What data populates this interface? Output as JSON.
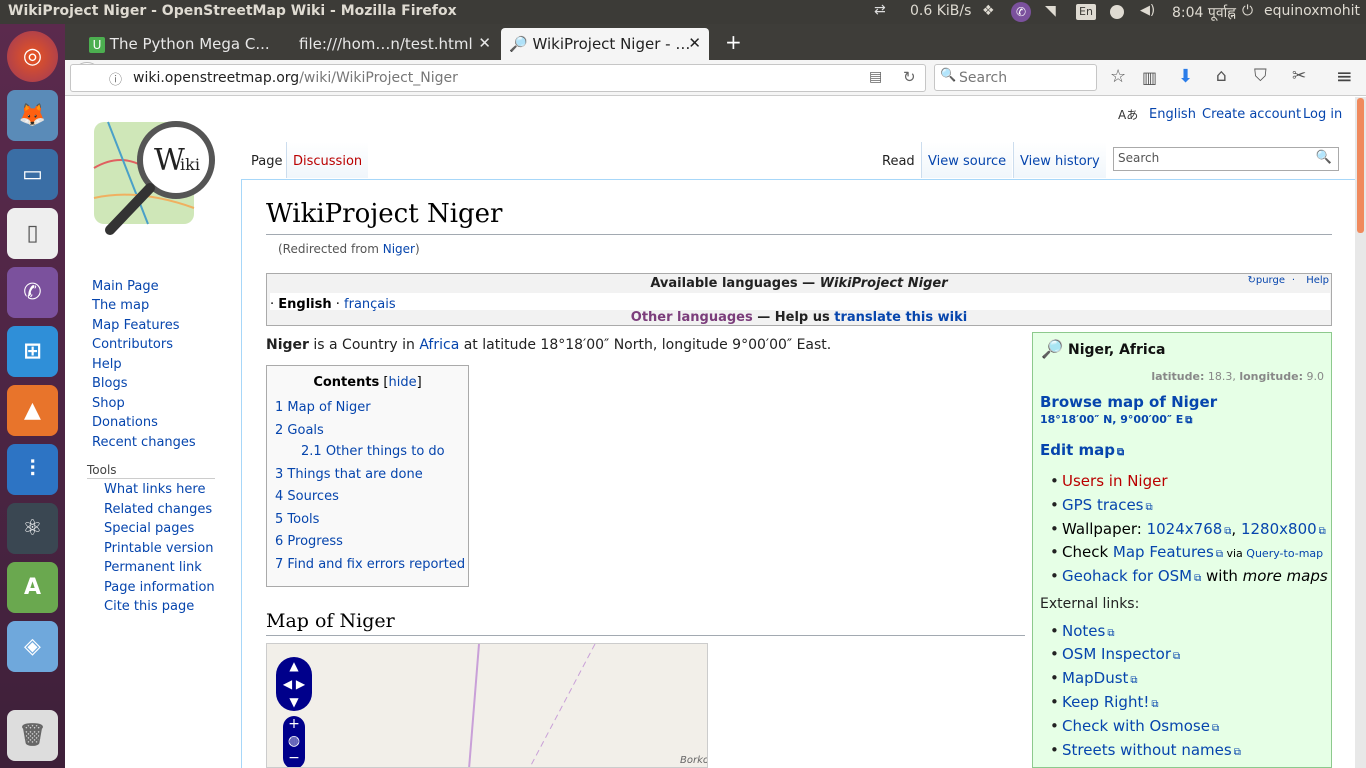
{
  "panel": {
    "window_title": "WikiProject Niger - OpenStreetMap Wiki - Mozilla Firefox",
    "net_speed": "0.6 KiB/s",
    "keyboard": "En",
    "volume_icon": "speaker-icon",
    "time": "8:04 पूर्वाह्न",
    "user": "equinoxmohit"
  },
  "launcher": {
    "items": [
      "ubuntu-dash-icon",
      "firefox-icon",
      "files-icon",
      "libreoffice-icon",
      "viber-icon",
      "app-store-icon",
      "vlc-icon",
      "mixer-icon",
      "atom-icon",
      "android-studio-icon",
      "virtualbox-icon",
      "trash-icon"
    ]
  },
  "tabs": [
    {
      "label": "The Python Mega C..."
    },
    {
      "label": "file:///hom…n/test.html"
    },
    {
      "label": "WikiProject Niger - …"
    }
  ],
  "nav": {
    "url_host": "wiki.openstreetmap.org",
    "url_path": "/wiki/WikiProject_Niger",
    "search_placeholder": "Search"
  },
  "personal": {
    "language": "English",
    "create_account": "Create account",
    "login": "Log in"
  },
  "tabs_wiki": {
    "page": "Page",
    "discussion": "Discussion",
    "read": "Read",
    "view_source": "View source",
    "view_history": "View history",
    "search_placeholder": "Search"
  },
  "sidebar": {
    "nav": [
      "Main Page",
      "The map",
      "Map Features",
      "Contributors",
      "Help",
      "Blogs",
      "Shop",
      "Donations",
      "Recent changes"
    ],
    "tools_heading": "Tools",
    "tools": [
      "What links here",
      "Related changes",
      "Special pages",
      "Printable version",
      "Permanent link",
      "Page information",
      "Cite this page"
    ]
  },
  "article": {
    "title": "WikiProject Niger",
    "redirect_prefix": "(Redirected from ",
    "redirect_link": "Niger",
    "redirect_suffix": ")",
    "lang_box": {
      "heading_prefix": "Available languages — ",
      "heading_title": "WikiProject Niger",
      "purge": "purge",
      "help": "Help",
      "english": "English",
      "francais": "français",
      "other_languages": "Other languages",
      "help_us": " — Help us ",
      "translate": "translate this wiki"
    },
    "intro": {
      "bold": "Niger",
      "text1": " is a Country in ",
      "link": "Africa",
      "text2": " at latitude 18°18′00″ North, longitude 9°00′00″ East."
    },
    "toc": {
      "title": "Contents",
      "hide": "hide",
      "items": [
        {
          "num": "1",
          "label": "Map of Niger"
        },
        {
          "num": "2",
          "label": "Goals"
        },
        {
          "num": "2.1",
          "label": "Other things to do"
        },
        {
          "num": "3",
          "label": "Things that are done"
        },
        {
          "num": "4",
          "label": "Sources"
        },
        {
          "num": "5",
          "label": "Tools"
        },
        {
          "num": "6",
          "label": "Progress"
        },
        {
          "num": "7",
          "label": "Find and fix errors reported"
        }
      ]
    },
    "section_heading": "Map of Niger",
    "map_label": "Borko"
  },
  "infobox": {
    "title": "Niger, Africa",
    "lat_label": "latitude:",
    "lat": "18.3",
    "lon_label": "longitude:",
    "lon": "9.0",
    "browse": "Browse map of Niger",
    "coords": "18°18′00″ N, 9°00′00″ E",
    "edit": "Edit map",
    "users": "Users in Niger",
    "gps": "GPS traces",
    "wallpaper": "Wallpaper: ",
    "res1": "1024x768",
    "res2": "1280x800",
    "check": "Check ",
    "map_features": "Map Features",
    "via": " via ",
    "query": "Query-to-map",
    "geohack": "Geohack for OSM",
    "with": " with ",
    "more_maps": "more maps",
    "external": "External links:",
    "ext_links": [
      "Notes",
      "OSM Inspector",
      "MapDust",
      "Keep Right!",
      "Check with Osmose",
      "Streets without names"
    ],
    "colors": {
      "bg": "#e6ffe6",
      "border": "#8dc98d"
    }
  }
}
